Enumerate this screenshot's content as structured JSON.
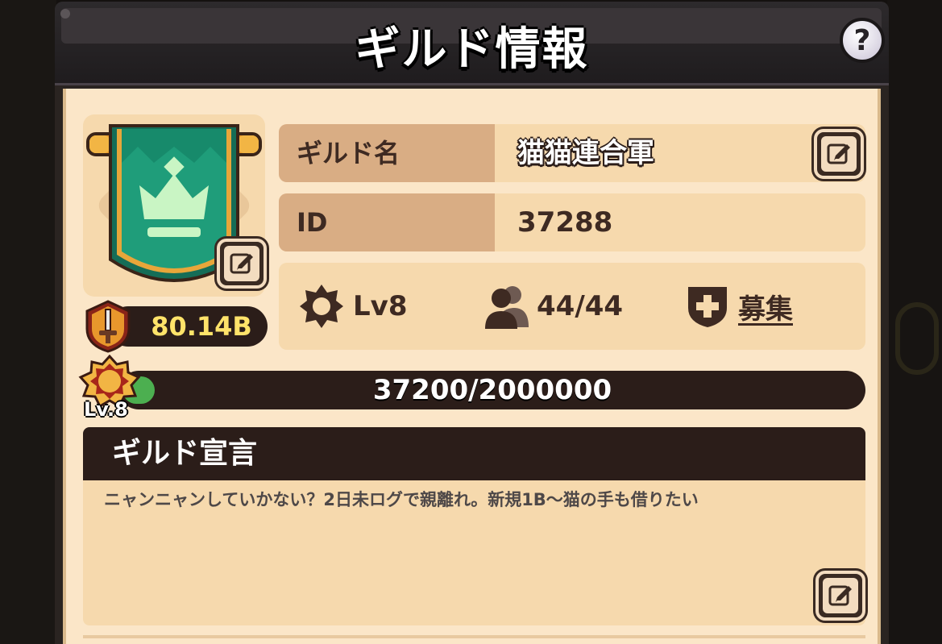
{
  "window": {
    "title": "ギルド情報"
  },
  "guild": {
    "name_label": "ギルド名",
    "name": "猫猫連合軍",
    "id_label": "ID",
    "id": "37288",
    "power": "80.14B",
    "level": "Lv8",
    "members": "44/44",
    "recruit_label": "募集",
    "xp": "37200/2000000",
    "xp_progress": 0.0186,
    "badge_level": "Lv.8"
  },
  "declaration": {
    "title": "ギルド宣言",
    "text": "ニャンニャンしていかない？2日未ログで親離れ。新規1B～猫の手も借りたい"
  },
  "icons": {
    "help": "question-icon",
    "edit": "pencil-icon",
    "emblem": "crown-banner-icon",
    "power": "sword-shield-icon",
    "level": "gear-badge-icon",
    "members": "people-icon",
    "recruit": "shield-plus-icon"
  },
  "colors": {
    "panel_bg": "#fbe6c8",
    "header_dark": "#2b1d19",
    "label_tan": "#d9ad84",
    "power_text": "#ffe36a",
    "banner_green": "#1f9d7a",
    "xp_green": "#4caf50"
  }
}
